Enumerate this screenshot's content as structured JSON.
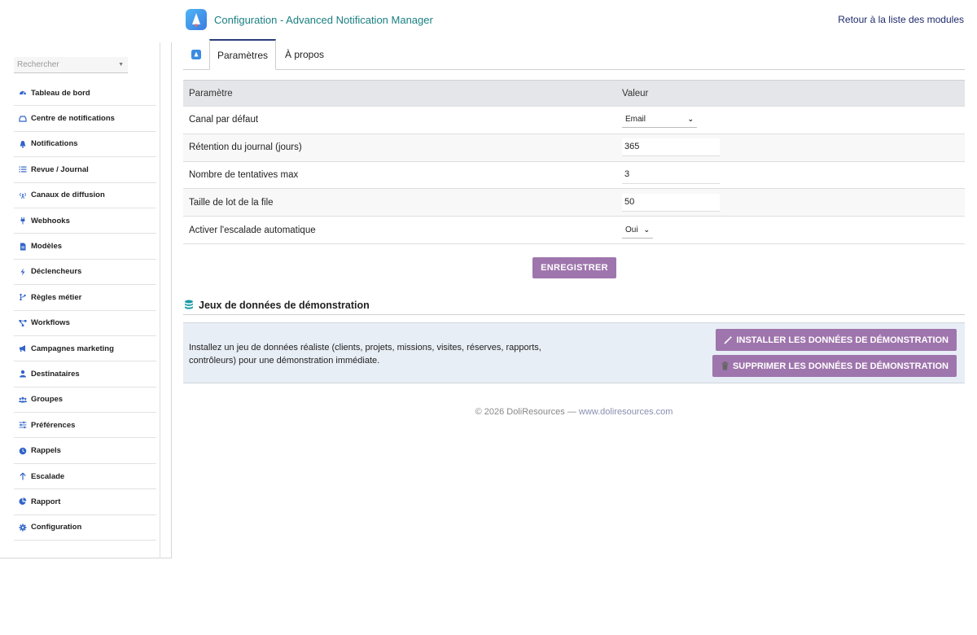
{
  "header": {
    "title": "Configuration - Advanced Notification Manager",
    "back_link": "Retour à la liste des modules"
  },
  "sidebar": {
    "search_placeholder": "Rechercher",
    "items": [
      {
        "label": "Tableau de bord",
        "icon": "dashboard-icon"
      },
      {
        "label": "Centre de notifications",
        "icon": "inbox-icon"
      },
      {
        "label": "Notifications",
        "icon": "bell-icon"
      },
      {
        "label": "Revue / Journal",
        "icon": "list-icon"
      },
      {
        "label": "Canaux de diffusion",
        "icon": "broadcast-icon"
      },
      {
        "label": "Webhooks",
        "icon": "plug-icon"
      },
      {
        "label": "Modèles",
        "icon": "file-icon"
      },
      {
        "label": "Déclencheurs",
        "icon": "bolt-icon"
      },
      {
        "label": "Règles métier",
        "icon": "branch-icon"
      },
      {
        "label": "Workflows",
        "icon": "workflow-icon"
      },
      {
        "label": "Campagnes marketing",
        "icon": "megaphone-icon"
      },
      {
        "label": "Destinataires",
        "icon": "user-icon"
      },
      {
        "label": "Groupes",
        "icon": "users-icon"
      },
      {
        "label": "Préférences",
        "icon": "sliders-icon"
      },
      {
        "label": "Rappels",
        "icon": "clock-icon"
      },
      {
        "label": "Escalade",
        "icon": "arrow-up-icon"
      },
      {
        "label": "Rapport",
        "icon": "pie-chart-icon"
      },
      {
        "label": "Configuration",
        "icon": "gear-icon"
      }
    ]
  },
  "tabs": {
    "active": "Paramètres",
    "about": "À propos"
  },
  "params": {
    "col_param": "Paramètre",
    "col_value": "Valeur",
    "rows": [
      {
        "label": "Canal par défaut",
        "type": "select",
        "value": "Email"
      },
      {
        "label": "Rétention du journal (jours)",
        "type": "text",
        "value": "365"
      },
      {
        "label": "Nombre de tentatives max",
        "type": "text",
        "value": "3"
      },
      {
        "label": "Taille de lot de la file",
        "type": "text",
        "value": "50"
      },
      {
        "label": "Activer l'escalade automatique",
        "type": "select",
        "value": "Oui"
      }
    ],
    "save_label": "ENREGISTRER"
  },
  "demo": {
    "title": "Jeux de données de démonstration",
    "text": "Installez un jeu de données réaliste (clients, projets, missions, visites, réserves, rapports, contrôleurs) pour une démonstration immédiate.",
    "install_label": "INSTALLER LES DONNÉES DE DÉMONSTRATION",
    "delete_label": "SUPPRIMER LES DONNÉES DE DÉMONSTRATION"
  },
  "footer": {
    "copyright": "© 2026 DoliResources — ",
    "link": "www.doliresources.com"
  },
  "colors": {
    "accent_button": "#9f75ad",
    "title_teal": "#1a7f82",
    "icon_blue": "#3163c9"
  }
}
